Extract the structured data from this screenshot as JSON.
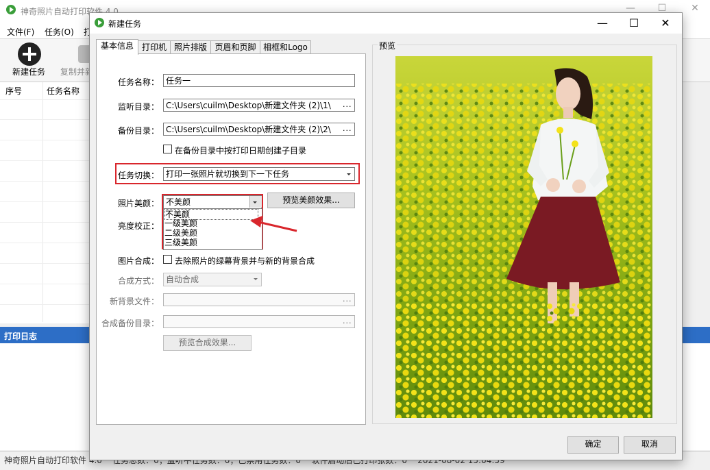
{
  "main_window": {
    "title": "神奇照片自动打印软件 4.0",
    "menu": [
      "文件(F)",
      "任务(O)",
      "打"
    ],
    "toolbar": {
      "new_task": "新建任务",
      "copy_partial": "复制并新"
    },
    "table_headers": [
      "序号",
      "任务名称"
    ],
    "log_title": "打印日志",
    "status_bar": "神奇照片自动打印软件 4.0    任务总数：0；监听中任务数：0；已禁用任务数：0    软件启动后已打印张数：0    2021-08-02 15:04:59"
  },
  "dialog": {
    "title": "新建任务",
    "tabs": [
      "基本信息",
      "打印机",
      "照片排版",
      "页眉和页脚",
      "相框和Logo"
    ],
    "active_tab": "基本信息",
    "form": {
      "task_name": {
        "label": "任务名称：",
        "value": "任务一"
      },
      "watch_dir": {
        "label": "监听目录：",
        "value": "C:\\Users\\cuilm\\Desktop\\新建文件夹 (2)\\1\\",
        "browse": "..."
      },
      "backup_dir": {
        "label": "备份目录：",
        "value": "C:\\Users\\cuilm\\Desktop\\新建文件夹 (2)\\2\\",
        "browse": "..."
      },
      "by_date_subdir": {
        "label": "在备份目录中按打印日期创建子目录",
        "checked": false
      },
      "task_switch": {
        "label": "任务切换：",
        "value": "打印一张照片就切换到下一下任务"
      },
      "beauty": {
        "label": "照片美颜：",
        "value": "不美颜",
        "options": [
          "不美颜",
          "一级美颜",
          "二级美颜",
          "三级美颜"
        ],
        "preview_button": "预览美颜效果..."
      },
      "brightness": {
        "label": "亮度校正："
      },
      "composite": {
        "label": "图片合成：",
        "checkbox_label": "去除照片的绿幕背景并与新的背景合成",
        "checked": false
      },
      "composite_mode": {
        "label": "合成方式：",
        "value": "自动合成"
      },
      "new_background": {
        "label": "新背景文件：",
        "value": "",
        "browse": "..."
      },
      "composite_backup": {
        "label": "合成备份目录：",
        "value": "",
        "browse": "..."
      },
      "preview_composite_button": "预览合成效果..."
    },
    "preview": {
      "title": "预览"
    },
    "buttons": {
      "ok": "确定",
      "cancel": "取消"
    }
  },
  "colors": {
    "highlight_red": "#d9262c",
    "log_header_blue": "#2d6ec6",
    "app_icon_green": "#3a9e3a"
  }
}
